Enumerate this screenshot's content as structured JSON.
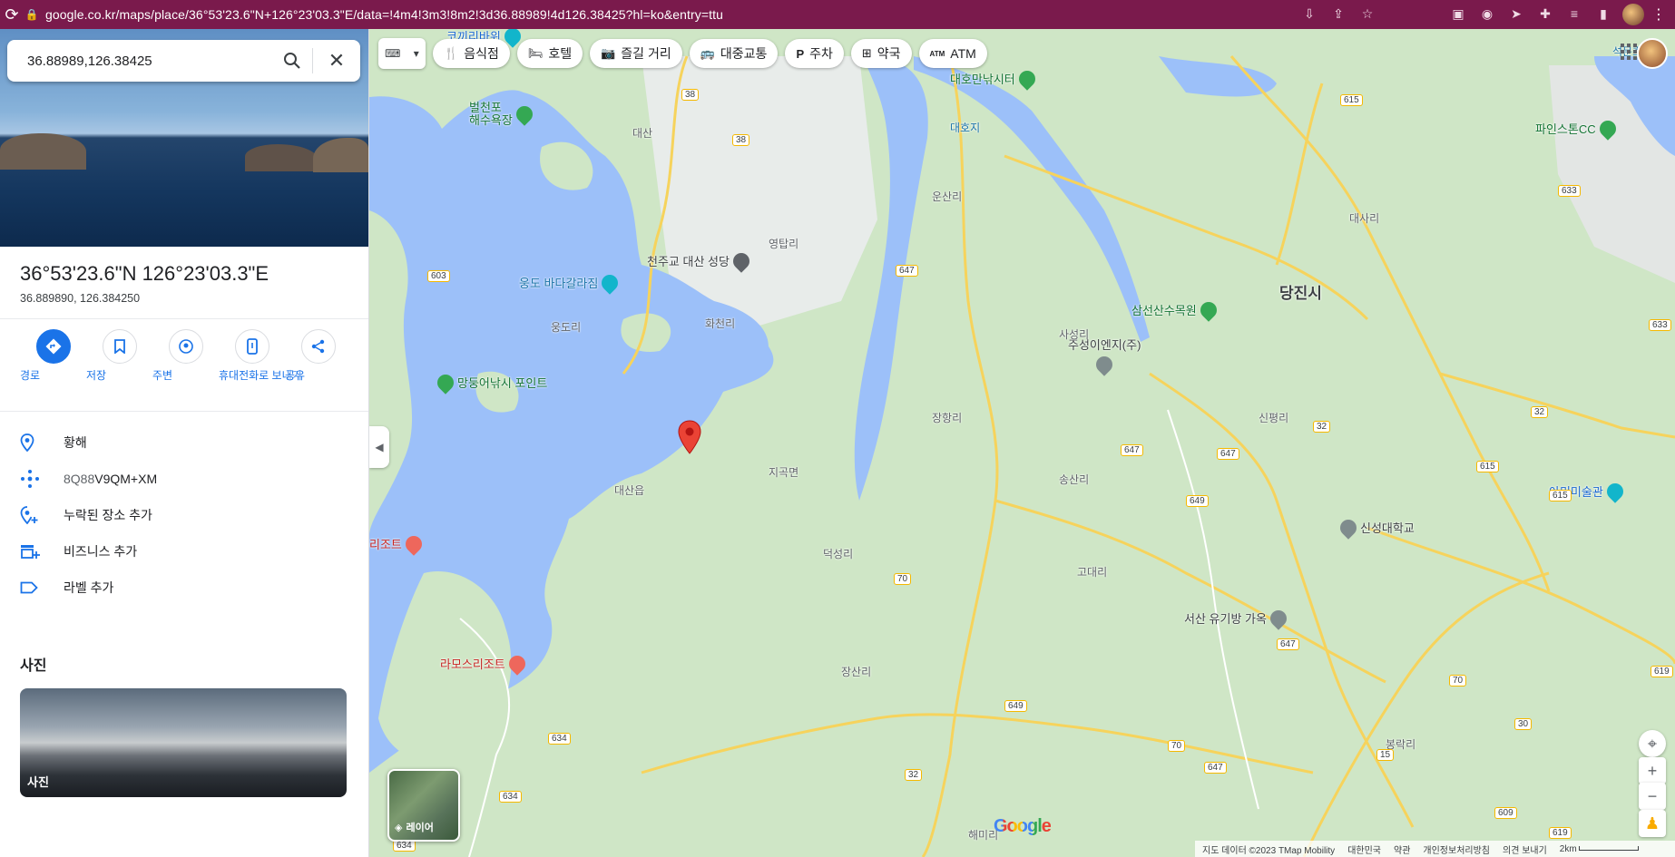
{
  "browser": {
    "url": "google.co.kr/maps/place/36°53'23.6\"N+126°23'03.3\"E/data=!4m4!3m3!8m2!3d36.88989!4d126.38425?hl=ko&entry=ttu"
  },
  "search": {
    "value": "36.88989,126.38425"
  },
  "place": {
    "title": "36°53'23.6\"N 126°23'03.3\"E",
    "coords": "36.889890, 126.384250"
  },
  "actions": [
    {
      "label": "경로"
    },
    {
      "label": "저장"
    },
    {
      "label": "주변"
    },
    {
      "label": "휴대전화로 보내기"
    },
    {
      "label": "공유"
    }
  ],
  "info": {
    "region": "황해",
    "plus_code_prefix": "8Q88",
    "plus_code_suffix": "V9QM+XM",
    "add_missing": "누락된 장소 추가",
    "add_business": "비즈니스 추가",
    "add_label": "라벨 추가"
  },
  "photos": {
    "heading": "사진",
    "thumb_label": "사진"
  },
  "chips": [
    {
      "label": "음식점",
      "icon": "fork-knife-icon"
    },
    {
      "label": "호텔",
      "icon": "bed-icon"
    },
    {
      "label": "즐길 거리",
      "icon": "camera-icon"
    },
    {
      "label": "대중교통",
      "icon": "bus-icon"
    },
    {
      "label": "주차",
      "icon": "parking-icon"
    },
    {
      "label": "약국",
      "icon": "pharmacy-icon"
    },
    {
      "label": "ATM",
      "icon": "atm-icon"
    }
  ],
  "map": {
    "layer_label": "레이어",
    "logo": "Google",
    "footer": {
      "data": "지도 데이터 ©2023 TMap Mobility",
      "country": "대한민국",
      "terms": "약관",
      "privacy": "개인정보처리방침",
      "feedback": "의견 보내기",
      "scale": "2km"
    },
    "labels": {
      "dangjin": "당진시",
      "pilgrim": "천주교 대산 성당",
      "ongdo": "웅도 바다갈라짐",
      "mangdong": "망둥어낚시 포인트",
      "beolcheon": "벌천포",
      "beolcheon2": "해수욕장",
      "daeho": "대호만낚시터",
      "pinestone": "파인스톤CC",
      "samseon": "삼선산수목원",
      "jusung": "주성이엔지(주)",
      "sinseong": "신성대학교",
      "amimi": "아미미술관",
      "seosan": "서산 유기방 가옥",
      "ramos": "라모스리조트",
      "resort": "리조트",
      "koggiri": "코끼리바위",
      "daesan": "대산",
      "hwacheon": "화천리",
      "daeho_sea": "대호지",
      "songsan": "송산리",
      "seokmun": "석문호",
      "godae": "고대리",
      "unsan": "운산리",
      "deokseong": "덕성리",
      "yeonggil": "영탑리",
      "seosan_city": "대산읍",
      "jigok": "지곡면",
      "ungdo": "웅도리",
      "sasan": "사성리",
      "jangsan": "장산리",
      "daesa": "대사리",
      "sinpyeong": "신평리",
      "haemi": "해미리",
      "myeon1": "봉락리",
      "myeon2": "장항리"
    },
    "routes": [
      "38",
      "38",
      "603",
      "647",
      "647",
      "647",
      "647",
      "649",
      "647",
      "649",
      "70",
      "70",
      "70",
      "32",
      "32",
      "32",
      "615",
      "615",
      "615",
      "633",
      "633",
      "619",
      "619",
      "634",
      "634",
      "634",
      "609",
      "15",
      "30"
    ]
  }
}
